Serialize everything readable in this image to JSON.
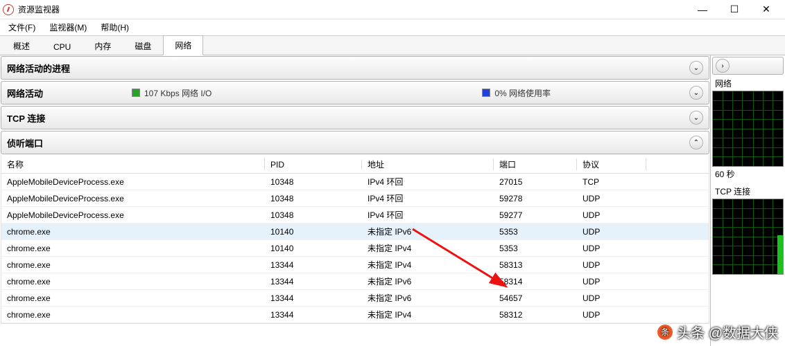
{
  "window": {
    "title": "资源监视器",
    "controls": {
      "min": "—",
      "max": "☐",
      "close": "✕"
    }
  },
  "menu": {
    "file": "文件(F)",
    "monitor": "监视器(M)",
    "help": "帮助(H)"
  },
  "tabs": {
    "overview": "概述",
    "cpu": "CPU",
    "memory": "内存",
    "disk": "磁盘",
    "network": "网络"
  },
  "sections": {
    "processes": {
      "title": "网络活动的进程"
    },
    "activity": {
      "title": "网络活动",
      "io_label": "107 Kbps 网络 I/O",
      "usage_label": "0% 网络使用率"
    },
    "tcp": {
      "title": "TCP 连接"
    },
    "listening": {
      "title": "侦听端口"
    }
  },
  "table": {
    "headers": {
      "name": "名称",
      "pid": "PID",
      "address": "地址",
      "port": "端口",
      "protocol": "协议"
    },
    "rows": [
      {
        "name": "AppleMobileDeviceProcess.exe",
        "pid": "10348",
        "address": "IPv4 环回",
        "port": "27015",
        "protocol": "TCP",
        "sel": false
      },
      {
        "name": "AppleMobileDeviceProcess.exe",
        "pid": "10348",
        "address": "IPv4 环回",
        "port": "59278",
        "protocol": "UDP",
        "sel": false
      },
      {
        "name": "AppleMobileDeviceProcess.exe",
        "pid": "10348",
        "address": "IPv4 环回",
        "port": "59277",
        "protocol": "UDP",
        "sel": false
      },
      {
        "name": "chrome.exe",
        "pid": "10140",
        "address": "未指定 IPv6",
        "port": "5353",
        "protocol": "UDP",
        "sel": true
      },
      {
        "name": "chrome.exe",
        "pid": "10140",
        "address": "未指定 IPv4",
        "port": "5353",
        "protocol": "UDP",
        "sel": false
      },
      {
        "name": "chrome.exe",
        "pid": "13344",
        "address": "未指定 IPv4",
        "port": "58313",
        "protocol": "UDP",
        "sel": false
      },
      {
        "name": "chrome.exe",
        "pid": "13344",
        "address": "未指定 IPv6",
        "port": "58314",
        "protocol": "UDP",
        "sel": false
      },
      {
        "name": "chrome.exe",
        "pid": "13344",
        "address": "未指定 IPv6",
        "port": "54657",
        "protocol": "UDP",
        "sel": false
      },
      {
        "name": "chrome.exe",
        "pid": "13344",
        "address": "未指定 IPv4",
        "port": "58312",
        "protocol": "UDP",
        "sel": false
      }
    ],
    "selected_index": 3
  },
  "side": {
    "chart1_label": "网络",
    "chart1_footer": "60 秒",
    "chart2_label": "TCP 连接"
  },
  "chevrons": {
    "down": "⌄",
    "up": "⌃",
    "right": "›"
  },
  "watermark": "头条 @数据大侠"
}
